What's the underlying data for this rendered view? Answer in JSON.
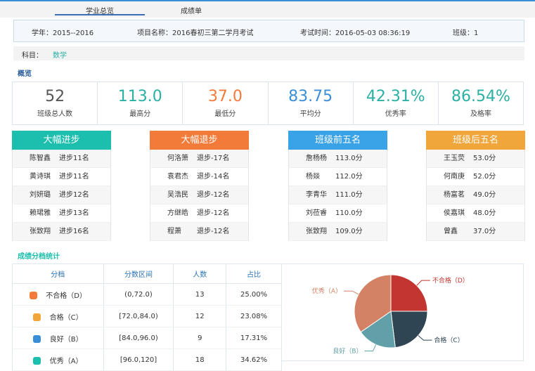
{
  "tabs": [
    {
      "label": "学业总览",
      "active": true
    },
    {
      "label": "成绩单",
      "active": false
    }
  ],
  "info": {
    "school_year": "学年：2015--2016",
    "project": "项目名称：2016春初三第二学月考试",
    "exam_time": "考试时间：2016-05-03 08:36:19",
    "class": "班级：1"
  },
  "subject": {
    "label": "科目：",
    "value": "数学"
  },
  "overview_title": "概览",
  "stats": [
    {
      "value": "52",
      "label": "班级总人数",
      "color": "#555555"
    },
    {
      "value": "113.0",
      "label": "最高分",
      "color": "#2ab0a4"
    },
    {
      "value": "37.0",
      "label": "最低分",
      "color": "#f37b3a"
    },
    {
      "value": "83.75",
      "label": "平均分",
      "color": "#3a8fd6"
    },
    {
      "value": "42.31%",
      "label": "优秀率",
      "color": "#2ab0a4"
    },
    {
      "value": "86.54%",
      "label": "及格率",
      "color": "#2ab0a4"
    }
  ],
  "rank_panels": [
    {
      "title": "大幅进步",
      "color": "#1cbfae",
      "rows": [
        {
          "name": "陈智鑫",
          "value": "进步11名"
        },
        {
          "name": "黄诗琪",
          "value": "进步11名"
        },
        {
          "name": "刘妍璐",
          "value": "进步12名"
        },
        {
          "name": "赖珺雅",
          "value": "进步13名"
        },
        {
          "name": "张致翔",
          "value": "进步16名"
        }
      ]
    },
    {
      "title": "大幅退步",
      "color": "#f37b3a",
      "rows": [
        {
          "name": "何洛箫",
          "value": "退步-17名"
        },
        {
          "name": "袁君杰",
          "value": "退步-14名"
        },
        {
          "name": "吴浩民",
          "value": "退步-12名"
        },
        {
          "name": "方继皓",
          "value": "退步-12名"
        },
        {
          "name": "程萧",
          "value": "退步-12名"
        }
      ]
    },
    {
      "title": "班级前五名",
      "color": "#3aa3e8",
      "rows": [
        {
          "name": "詹杨杨",
          "value": "113.0分"
        },
        {
          "name": "杨燚",
          "value": "112.0分"
        },
        {
          "name": "李青华",
          "value": "111.0分"
        },
        {
          "name": "刘莅睿",
          "value": "110.0分"
        },
        {
          "name": "张致翔",
          "value": "109.0分"
        }
      ]
    },
    {
      "title": "班级后五名",
      "color": "#f0a63a",
      "rows": [
        {
          "name": "王玉荧",
          "value": "53.0分"
        },
        {
          "name": "何南庚",
          "value": "52.0分"
        },
        {
          "name": "杨富茗",
          "value": "49.0分"
        },
        {
          "name": "侯嘉琪",
          "value": "48.0分"
        },
        {
          "name": "曾鑫",
          "value": "37.0分"
        }
      ]
    }
  ],
  "distribution_title": "成绩分档统计",
  "distribution": {
    "headers": [
      "分档",
      "分数区间",
      "人数",
      "占比"
    ],
    "rows": [
      {
        "level": "不合格（D）",
        "range": "(0,72.0)",
        "count": "13",
        "ratio": "25.00%",
        "dot_color": "#f37b3a"
      },
      {
        "level": "合格（C）",
        "range": "[72.0,84.0)",
        "count": "12",
        "ratio": "23.08%",
        "dot_color": "#f0a63a"
      },
      {
        "level": "良好（B）",
        "range": "[84.0,96.0)",
        "count": "9",
        "ratio": "17.31%",
        "dot_color": "#3a8fd6"
      },
      {
        "level": "优秀（A）",
        "range": "[96.0,120]",
        "count": "18",
        "ratio": "34.62%",
        "dot_color": "#1cbfae"
      }
    ]
  },
  "chart_data": {
    "type": "pie",
    "slices": [
      {
        "label": "不合格（D）",
        "value": 25.0,
        "color": "#c23531"
      },
      {
        "label": "合格（C）",
        "value": 23.08,
        "color": "#2f4554"
      },
      {
        "label": "良好（B）",
        "value": 17.31,
        "color": "#61a0a8"
      },
      {
        "label": "优秀（A）",
        "value": 34.62,
        "color": "#d48265"
      }
    ]
  }
}
